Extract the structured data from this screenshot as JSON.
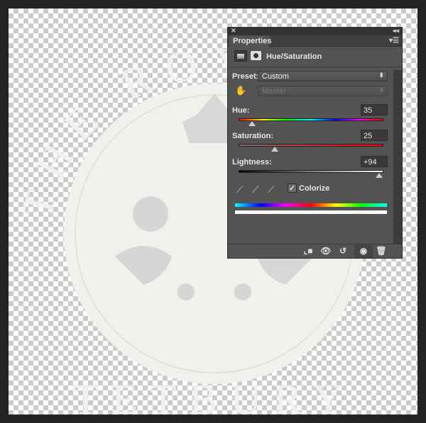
{
  "logo": {
    "top_text": "THE ROYAL",
    "bottom_text": "TETBURY",
    "color": "#f2f0ed"
  },
  "panel": {
    "title": "Properties",
    "adjustment": "Hue/Saturation",
    "preset_label": "Preset:",
    "preset_value": "Custom",
    "channel_value": "Master",
    "hue": {
      "label": "Hue:",
      "value": "35",
      "min": -180,
      "max": 180
    },
    "saturation": {
      "label": "Saturation:",
      "value": "25",
      "min": -100,
      "max": 100
    },
    "lightness": {
      "label": "Lightness:",
      "value": "+94",
      "min": -100,
      "max": 100
    },
    "colorize_label": "Colorize",
    "colorize_checked": true,
    "icons": [
      "close-icon",
      "collapse-icon",
      "panel-menu-icon",
      "adjustment-layer-icon",
      "mask-icon",
      "targeted-adjustment-hand-icon",
      "eyedropper-icon",
      "eyedropper-plus-icon",
      "eyedropper-minus-icon",
      "clip-to-layer-icon",
      "view-previous-state-icon",
      "reset-icon",
      "visibility-icon",
      "trash-icon"
    ]
  }
}
